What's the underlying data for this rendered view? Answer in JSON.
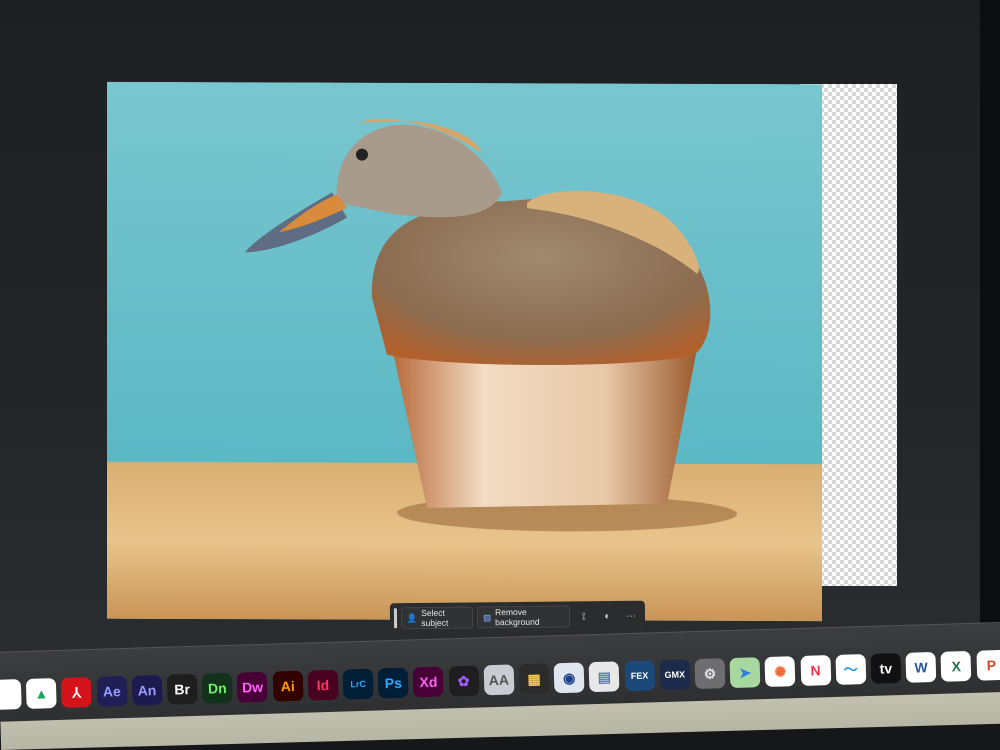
{
  "canvas": {
    "subject": "duck-muffin composite",
    "background_color": "#6cc2cc"
  },
  "contextual_taskbar": {
    "select_subject": "Select subject",
    "remove_background": "Remove background",
    "more": "···"
  },
  "dock": {
    "items": [
      {
        "name": "chrome",
        "label": "",
        "bg": "#ffffff",
        "fg": "#db4437"
      },
      {
        "name": "google-drive",
        "label": "▲",
        "bg": "#ffffff",
        "fg": "#1fa463"
      },
      {
        "name": "acrobat",
        "label": "⅄",
        "bg": "#d4131b",
        "fg": "#ffffff"
      },
      {
        "name": "after-effects",
        "label": "Ae",
        "bg": "#1f1f55",
        "fg": "#9999ff"
      },
      {
        "name": "animate",
        "label": "An",
        "bg": "#1d1a4f",
        "fg": "#9a9aff"
      },
      {
        "name": "bridge",
        "label": "Br",
        "bg": "#1e1e1e",
        "fg": "#ffffff"
      },
      {
        "name": "dimension",
        "label": "Dn",
        "bg": "#12321b",
        "fg": "#6ff26a"
      },
      {
        "name": "dreamweaver",
        "label": "Dw",
        "bg": "#470137",
        "fg": "#ff61f6"
      },
      {
        "name": "illustrator",
        "label": "Ai",
        "bg": "#330000",
        "fg": "#ff9a00"
      },
      {
        "name": "indesign",
        "label": "Id",
        "bg": "#49021f",
        "fg": "#ff3366"
      },
      {
        "name": "lightroom-classic",
        "label": "LrC",
        "bg": "#001e36",
        "fg": "#31a8ff"
      },
      {
        "name": "photoshop",
        "label": "Ps",
        "bg": "#001e36",
        "fg": "#31a8ff"
      },
      {
        "name": "xd",
        "label": "Xd",
        "bg": "#470137",
        "fg": "#ff61f6"
      },
      {
        "name": "figma",
        "label": "✿",
        "bg": "#1e1e1e",
        "fg": "#a259ff"
      },
      {
        "name": "font-book",
        "label": "AA",
        "bg": "#c9ccd2",
        "fg": "#555555"
      },
      {
        "name": "final-cut-pro",
        "label": "▦",
        "bg": "#2b2b2b",
        "fg": "#f7c948"
      },
      {
        "name": "cinema-4d",
        "label": "◉",
        "bg": "#dfe6f0",
        "fg": "#1b3f8b"
      },
      {
        "name": "preview",
        "label": "▤",
        "bg": "#e8e8e8",
        "fg": "#5a7fb5"
      },
      {
        "name": "fex",
        "label": "FEX",
        "bg": "#1b4a7a",
        "fg": "#ffffff"
      },
      {
        "name": "gmx",
        "label": "GMX",
        "bg": "#1c2b4b",
        "fg": "#ffffff"
      },
      {
        "name": "system-preferences",
        "label": "⚙",
        "bg": "#6e6e70",
        "fg": "#e0e0e0"
      },
      {
        "name": "maps",
        "label": "➤",
        "bg": "#a7d8a0",
        "fg": "#2f7de1"
      },
      {
        "name": "photos",
        "label": "✺",
        "bg": "#ffffff",
        "fg": "#f26b3a"
      },
      {
        "name": "news",
        "label": "N",
        "bg": "#ffffff",
        "fg": "#fa2e4c"
      },
      {
        "name": "freeform",
        "label": "〜",
        "bg": "#ffffff",
        "fg": "#2d9cdb"
      },
      {
        "name": "apple-tv",
        "label": "tv",
        "bg": "#111111",
        "fg": "#ffffff"
      },
      {
        "name": "word",
        "label": "W",
        "bg": "#ffffff",
        "fg": "#2b579a"
      },
      {
        "name": "excel",
        "label": "X",
        "bg": "#ffffff",
        "fg": "#217346"
      },
      {
        "name": "powerpoint",
        "label": "P",
        "bg": "#ffffff",
        "fg": "#d24726"
      }
    ]
  }
}
